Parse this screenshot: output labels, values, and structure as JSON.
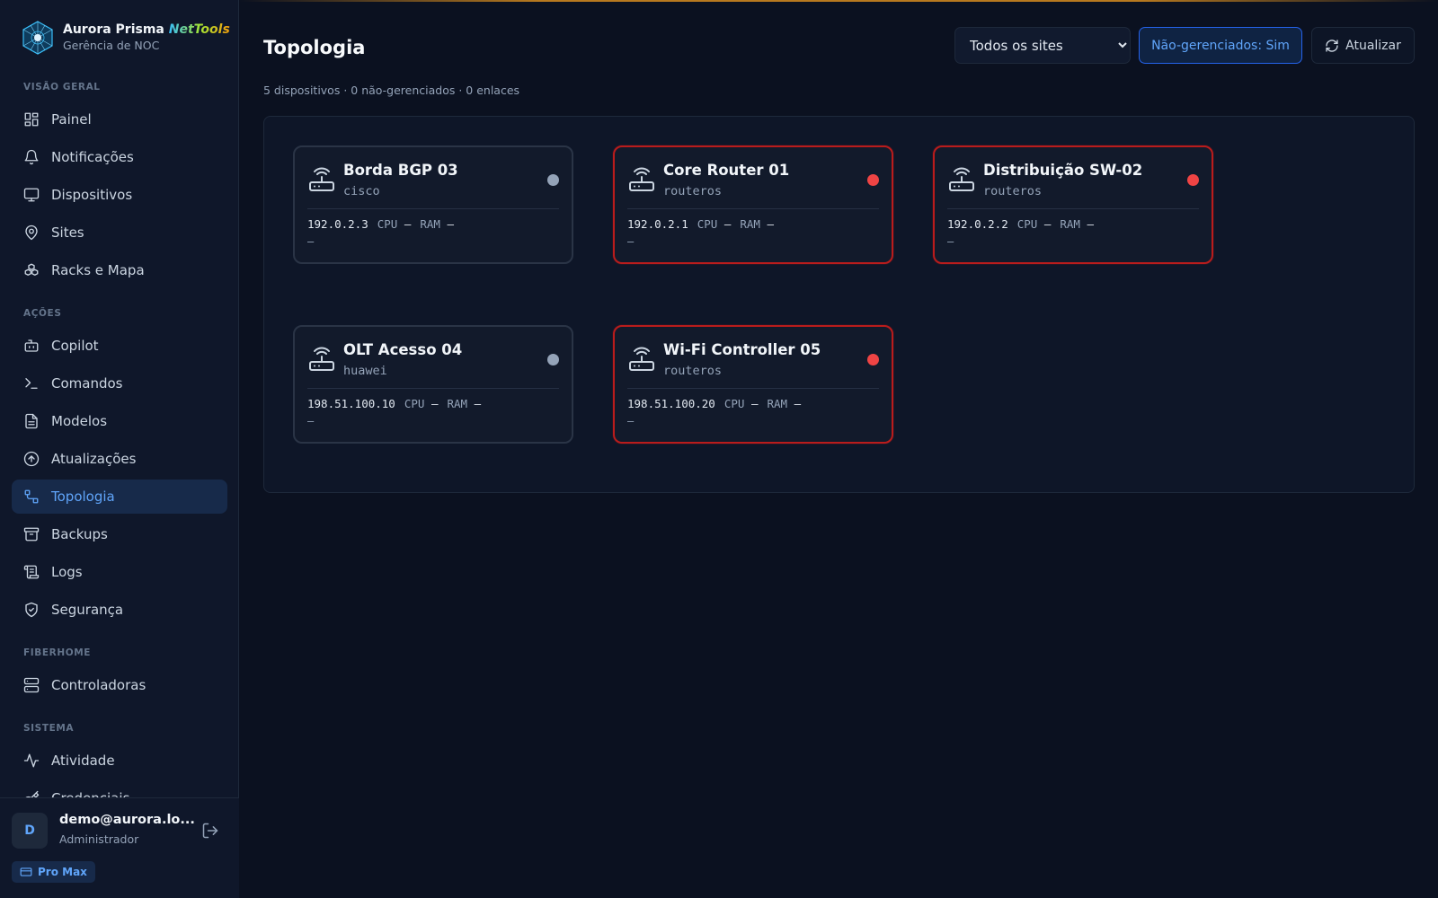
{
  "brand": {
    "name": "Aurora Prisma",
    "accent": "NetTools",
    "subtitle": "Gerência de NOC"
  },
  "sidebar": {
    "sections": [
      {
        "title": "VISÃO GERAL",
        "items": [
          {
            "label": "Painel",
            "icon": "grid-icon"
          },
          {
            "label": "Notificações",
            "icon": "bell-icon"
          },
          {
            "label": "Dispositivos",
            "icon": "monitor-icon"
          },
          {
            "label": "Sites",
            "icon": "map-pin-icon"
          },
          {
            "label": "Racks e Mapa",
            "icon": "boxes-icon"
          }
        ]
      },
      {
        "title": "AÇÕES",
        "items": [
          {
            "label": "Copilot",
            "icon": "bot-icon"
          },
          {
            "label": "Comandos",
            "icon": "terminal-icon"
          },
          {
            "label": "Modelos",
            "icon": "file-text-icon"
          },
          {
            "label": "Atualizações",
            "icon": "arrow-up-circle-icon"
          },
          {
            "label": "Topologia",
            "icon": "topology-icon",
            "active": true
          },
          {
            "label": "Backups",
            "icon": "archive-icon"
          },
          {
            "label": "Logs",
            "icon": "scroll-icon"
          },
          {
            "label": "Segurança",
            "icon": "shield-icon"
          }
        ]
      },
      {
        "title": "FIBERHOME",
        "items": [
          {
            "label": "Controladoras",
            "icon": "server-icon"
          }
        ]
      },
      {
        "title": "SISTEMA",
        "items": [
          {
            "label": "Atividade",
            "icon": "activity-icon"
          },
          {
            "label": "Credenciais",
            "icon": "key-icon"
          }
        ]
      }
    ]
  },
  "user": {
    "initial": "D",
    "email": "demo@aurora.lo...",
    "role": "Administrador",
    "plan": "Pro Max"
  },
  "header": {
    "title": "Topologia",
    "summary": "5 dispositivos · 0 não-gerenciados · 0 enlaces",
    "site_select": {
      "value": "Todos os sites",
      "options": [
        "Todos os sites"
      ]
    },
    "unmanaged_button": "Não-gerenciados: Sim",
    "refresh_button": "Atualizar"
  },
  "colors": {
    "accent": "#60a5fa",
    "status_down": "#ef4444",
    "status_unknown": "#94a3b8",
    "alert_border": "#b91c1c"
  },
  "devices": [
    {
      "name": "Borda BGP 03",
      "vendor": "cisco",
      "ip": "192.0.2.3",
      "cpu_label": "CPU",
      "cpu": "—",
      "ram_label": "RAM",
      "ram": "—",
      "extra": "—",
      "status": "unknown",
      "alert": false
    },
    {
      "name": "Core Router 01",
      "vendor": "routeros",
      "ip": "192.0.2.1",
      "cpu_label": "CPU",
      "cpu": "—",
      "ram_label": "RAM",
      "ram": "—",
      "extra": "—",
      "status": "down",
      "alert": true
    },
    {
      "name": "Distribuição SW-02",
      "vendor": "routeros",
      "ip": "192.0.2.2",
      "cpu_label": "CPU",
      "cpu": "—",
      "ram_label": "RAM",
      "ram": "—",
      "extra": "—",
      "status": "down",
      "alert": true
    },
    {
      "name": "OLT Acesso 04",
      "vendor": "huawei",
      "ip": "198.51.100.10",
      "cpu_label": "CPU",
      "cpu": "—",
      "ram_label": "RAM",
      "ram": "—",
      "extra": "—",
      "status": "unknown",
      "alert": false
    },
    {
      "name": "Wi-Fi Controller 05",
      "vendor": "routeros",
      "ip": "198.51.100.20",
      "cpu_label": "CPU",
      "cpu": "—",
      "ram_label": "RAM",
      "ram": "—",
      "extra": "—",
      "status": "down",
      "alert": true
    }
  ]
}
